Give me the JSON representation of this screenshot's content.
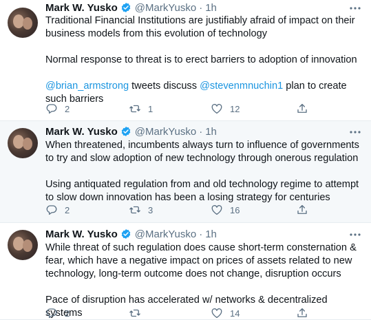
{
  "tweets": [
    {
      "author_name": "Mark W. Yusko",
      "handle": "@MarkYusko",
      "separator": "·",
      "time": "1h",
      "para1": "Traditional Financial Institutions are justifiably afraid of impact on their business models from this evolution of technology",
      "para2": "Normal response to threat is to erect barriers to adoption of innovation",
      "para3": {
        "mention1": "@brian_armstrong",
        "text1": " tweets discuss ",
        "mention2": "@stevenmnuchin1",
        "text2": " plan to create such barriers"
      },
      "replies": "2",
      "retweets": "1",
      "likes": "12"
    },
    {
      "author_name": "Mark W. Yusko",
      "handle": "@MarkYusko",
      "separator": "·",
      "time": "1h",
      "para1": "When threatened, incumbents always turn to influence of governments to try and slow adoption of new technology through onerous regulation",
      "para2": "Using antiquated regulation from and old technology regime to attempt to slow down innovation has been a losing strategy for centuries",
      "replies": "2",
      "retweets": "3",
      "likes": "16"
    },
    {
      "author_name": "Mark W. Yusko",
      "handle": "@MarkYusko",
      "separator": "·",
      "time": "1h",
      "para1": "While threat of such regulation does cause short-term consternation & fear, which have a negative impact on prices of assets related to new technology, long-term outcome does not change, disruption occurs",
      "para2": "Pace of disruption has accelerated w/ networks & decentralized systems",
      "replies": "2",
      "retweets": "",
      "likes": "14"
    }
  ],
  "icons": {
    "verified": "verified-badge-icon",
    "more": "more-icon",
    "reply": "reply-icon",
    "retweet": "retweet-icon",
    "like": "like-icon",
    "share": "share-icon"
  },
  "colors": {
    "text": "#0f1419",
    "secondary": "#5b7083",
    "accent": "#1b95e0",
    "highlight_bg": "#f5f8fa",
    "divider": "#e6ecf0"
  }
}
